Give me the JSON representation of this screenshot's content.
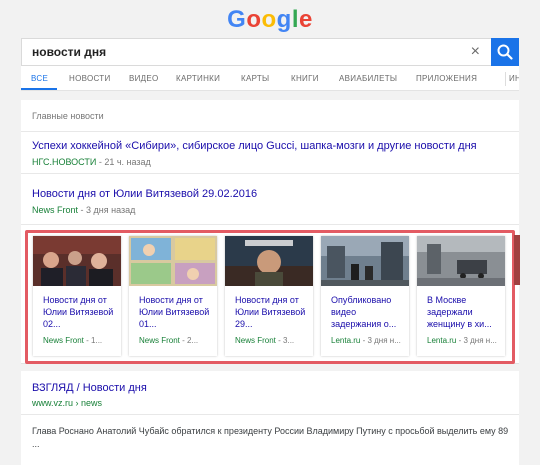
{
  "logo": {
    "letters": [
      {
        "ch": "G",
        "color": "#4285F4"
      },
      {
        "ch": "o",
        "color": "#EA4335"
      },
      {
        "ch": "o",
        "color": "#FBBC05"
      },
      {
        "ch": "g",
        "color": "#4285F4"
      },
      {
        "ch": "l",
        "color": "#34A853"
      },
      {
        "ch": "e",
        "color": "#EA4335"
      }
    ]
  },
  "search": {
    "query": "новости дня",
    "clear_icon": "×"
  },
  "tabs": [
    "ВСЕ",
    "НОВОСТИ",
    "ВИДЕО",
    "КАРТИНКИ",
    "КАРТЫ",
    "КНИГИ",
    "АВИАБИЛЕТЫ",
    "ПРИЛОЖЕНИЯ",
    "ИН"
  ],
  "top_news": {
    "header": "Главные новости",
    "stories": [
      {
        "title": "Успехи хоккейной «Сибири», сибирское лицо Gucci, шапка-мозги и другие новости дня",
        "source": "НГС.НОВОСТИ",
        "time": " - 21 ч. назад"
      },
      {
        "title": "Новости дня от Юлии Витязевой 29.02.2016",
        "source": "News Front",
        "time": " - 3 дня назад"
      }
    ],
    "carousel": [
      {
        "text": "Новости дня от Юлии Витязевой 02...",
        "source": "News Front",
        "time": " - 1..."
      },
      {
        "text": "Новости дня от Юлии Витязевой 01...",
        "source": "News Front",
        "time": " - 2..."
      },
      {
        "text": "Новости дня от Юлии Витязевой 29...",
        "source": "News Front",
        "time": " - 3..."
      },
      {
        "text": "Опубликовано видео задержания о...",
        "source": "Lenta.ru",
        "time": " - 3 дня н..."
      },
      {
        "text": "В Москве задержали женщину в хи...",
        "source": "Lenta.ru",
        "time": " - 3 дня н..."
      }
    ]
  },
  "result": {
    "title": "ВЗГЛЯД / Новости дня",
    "url": "www.vz.ru › news",
    "snippet": "Глава Роснано Анатолий Чубайс обратился к президенту России Владимиру Путину с просьбой выделить ему 89 ..."
  },
  "colors": {
    "accent": "#1a73e8",
    "link": "#1a0dab",
    "source": "#188038",
    "highlight_frame": "#e35b63"
  }
}
